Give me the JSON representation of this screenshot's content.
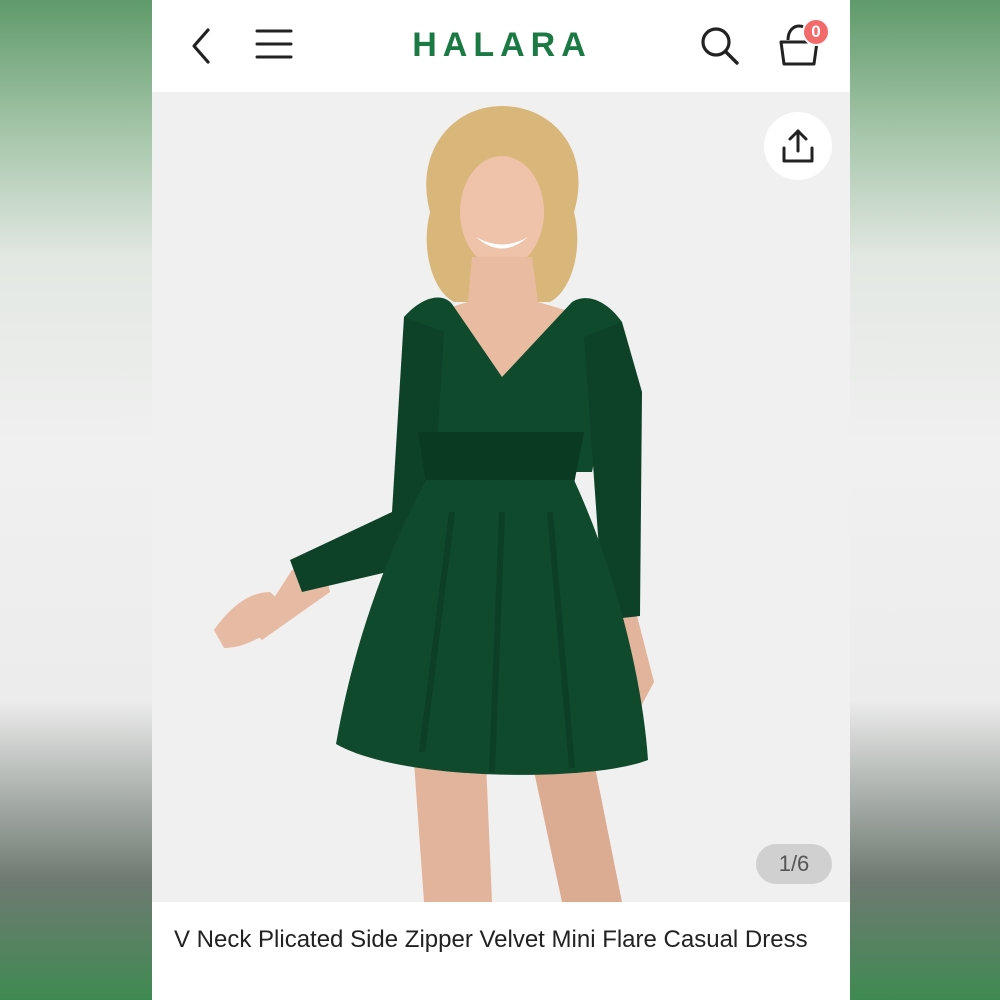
{
  "header": {
    "brand": "HALARA",
    "cart_count": "0",
    "icons": {
      "back": "chevron-left-icon",
      "menu": "hamburger-menu-icon",
      "search": "search-icon",
      "cart": "shopping-bag-icon",
      "share": "share-icon"
    },
    "brand_color": "#1b7a43",
    "badge_color": "#f26a6a"
  },
  "gallery": {
    "counter": "1/6",
    "current_image": 1,
    "total_images": 6,
    "dress_color": "#0f4a2c"
  },
  "product": {
    "title": "V Neck Plicated Side Zipper Velvet Mini Flare Casual Dress"
  }
}
